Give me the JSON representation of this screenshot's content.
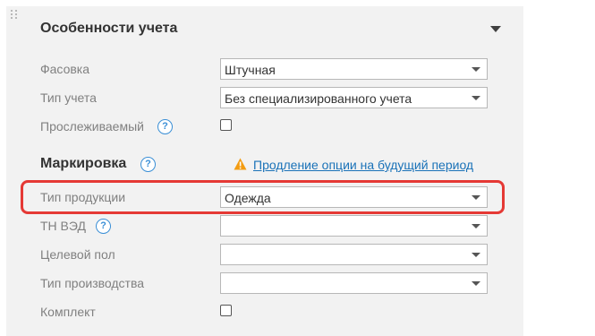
{
  "section": {
    "title": "Особенности учета"
  },
  "fields": {
    "packaging": {
      "label": "Фасовка",
      "value": "Штучная"
    },
    "accounting_type": {
      "label": "Тип учета",
      "value": "Без специализированного учета"
    },
    "traceable": {
      "label": "Прослеживаемый",
      "checked": false
    }
  },
  "marking": {
    "title": "Маркировка",
    "link": "Продление опции на будущий период",
    "product_type": {
      "label": "Тип продукции",
      "value": "Одежда"
    },
    "tn_ved": {
      "label": "ТН ВЭД",
      "value": ""
    },
    "gender": {
      "label": "Целевой пол",
      "value": ""
    },
    "production_type": {
      "label": "Тип производства",
      "value": ""
    },
    "kit": {
      "label": "Комплект",
      "checked": false
    }
  },
  "help_glyph": "?",
  "colors": {
    "panel_bg": "#f2f2f2",
    "label": "#808080",
    "link": "#1a72b8",
    "help": "#3a8fd6",
    "warning": "#f39c12",
    "highlight": "#e53935"
  }
}
